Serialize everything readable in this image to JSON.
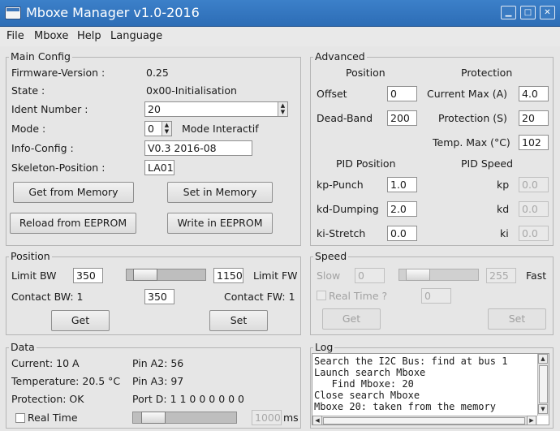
{
  "window": {
    "title": "Mboxe Manager v1.0-2016",
    "minimize": "▁",
    "maximize": "□",
    "close": "✕"
  },
  "menu": {
    "file": "File",
    "mboxe": "Mboxe",
    "help": "Help",
    "language": "Language"
  },
  "main_config": {
    "legend": "Main Config",
    "firmware_label": "Firmware-Version :",
    "firmware_value": "0.25",
    "state_label": "State :",
    "state_value": "0x00-Initialisation",
    "ident_label": "Ident Number :",
    "ident_value": "20",
    "mode_label": "Mode :",
    "mode_value": "0",
    "mode_text": "Mode Interactif",
    "info_label": "Info-Config :",
    "info_value": "V0.3 2016-08",
    "skeleton_label": "Skeleton-Position :",
    "skeleton_value": "LA01",
    "get_memory": "Get from Memory",
    "set_memory": "Set in Memory",
    "reload_eeprom": "Reload from EEPROM",
    "write_eeprom": "Write in EEPROM"
  },
  "advanced": {
    "legend": "Advanced",
    "position_header": "Position",
    "protection_header": "Protection",
    "offset_label": "Offset",
    "offset_value": "0",
    "deadband_label": "Dead-Band",
    "deadband_value": "200",
    "current_max_label": "Current Max  (A)",
    "current_max_value": "4.0",
    "protection_label": "Protection (S)",
    "protection_value": "20",
    "temp_max_label": "Temp. Max (°C)",
    "temp_max_value": "102",
    "pid_position_header": "PID Position",
    "pid_speed_header": "PID Speed",
    "kp_punch_label": "kp-Punch",
    "kp_punch_value": "1.0",
    "kd_dumping_label": "kd-Dumping",
    "kd_dumping_value": "2.0",
    "ki_stretch_label": "ki-Stretch",
    "ki_stretch_value": "0.0",
    "kp_label": "kp",
    "kp_value": "0.0",
    "kd_label": "kd",
    "kd_value": "0.0",
    "ki_label": "ki",
    "ki_value": "0.0"
  },
  "position": {
    "legend": "Position",
    "limit_bw_label": "Limit BW",
    "limit_bw_value": "350",
    "limit_fw_label": "Limit FW",
    "limit_fw_value": "1150",
    "slider_level": 0.12,
    "contact_bw": "Contact BW: 1",
    "contact_value": "350",
    "contact_fw": "Contact FW: 1",
    "get": "Get",
    "set": "Set"
  },
  "speed": {
    "legend": "Speed",
    "slow_label": "Slow",
    "slow_value": "0",
    "fast_label": "Fast",
    "fast_value": "255",
    "slider_level": 0.12,
    "realtime_label": "Real Time ?",
    "realtime_value": "0",
    "get": "Get",
    "set": "Set"
  },
  "data": {
    "legend": "Data",
    "current": "Current: 10 A",
    "pin_a2": "Pin A2: 56",
    "temperature": "Temperature: 20.5 °C",
    "pin_a3": "Pin A3: 97",
    "protection": "Protection: OK",
    "port_d": "Port D: 1 1 0 0 0 0 0 0",
    "realtime_label": "Real Time",
    "interval_value": "1000",
    "interval_unit": "ms"
  },
  "log": {
    "legend": "Log",
    "lines": [
      "Search the I2C Bus: find at bus 1",
      "Launch search Mboxe",
      "   Find Mboxe: 20",
      "Close search Mboxe",
      "Mboxe 20: taken from the memory"
    ]
  }
}
